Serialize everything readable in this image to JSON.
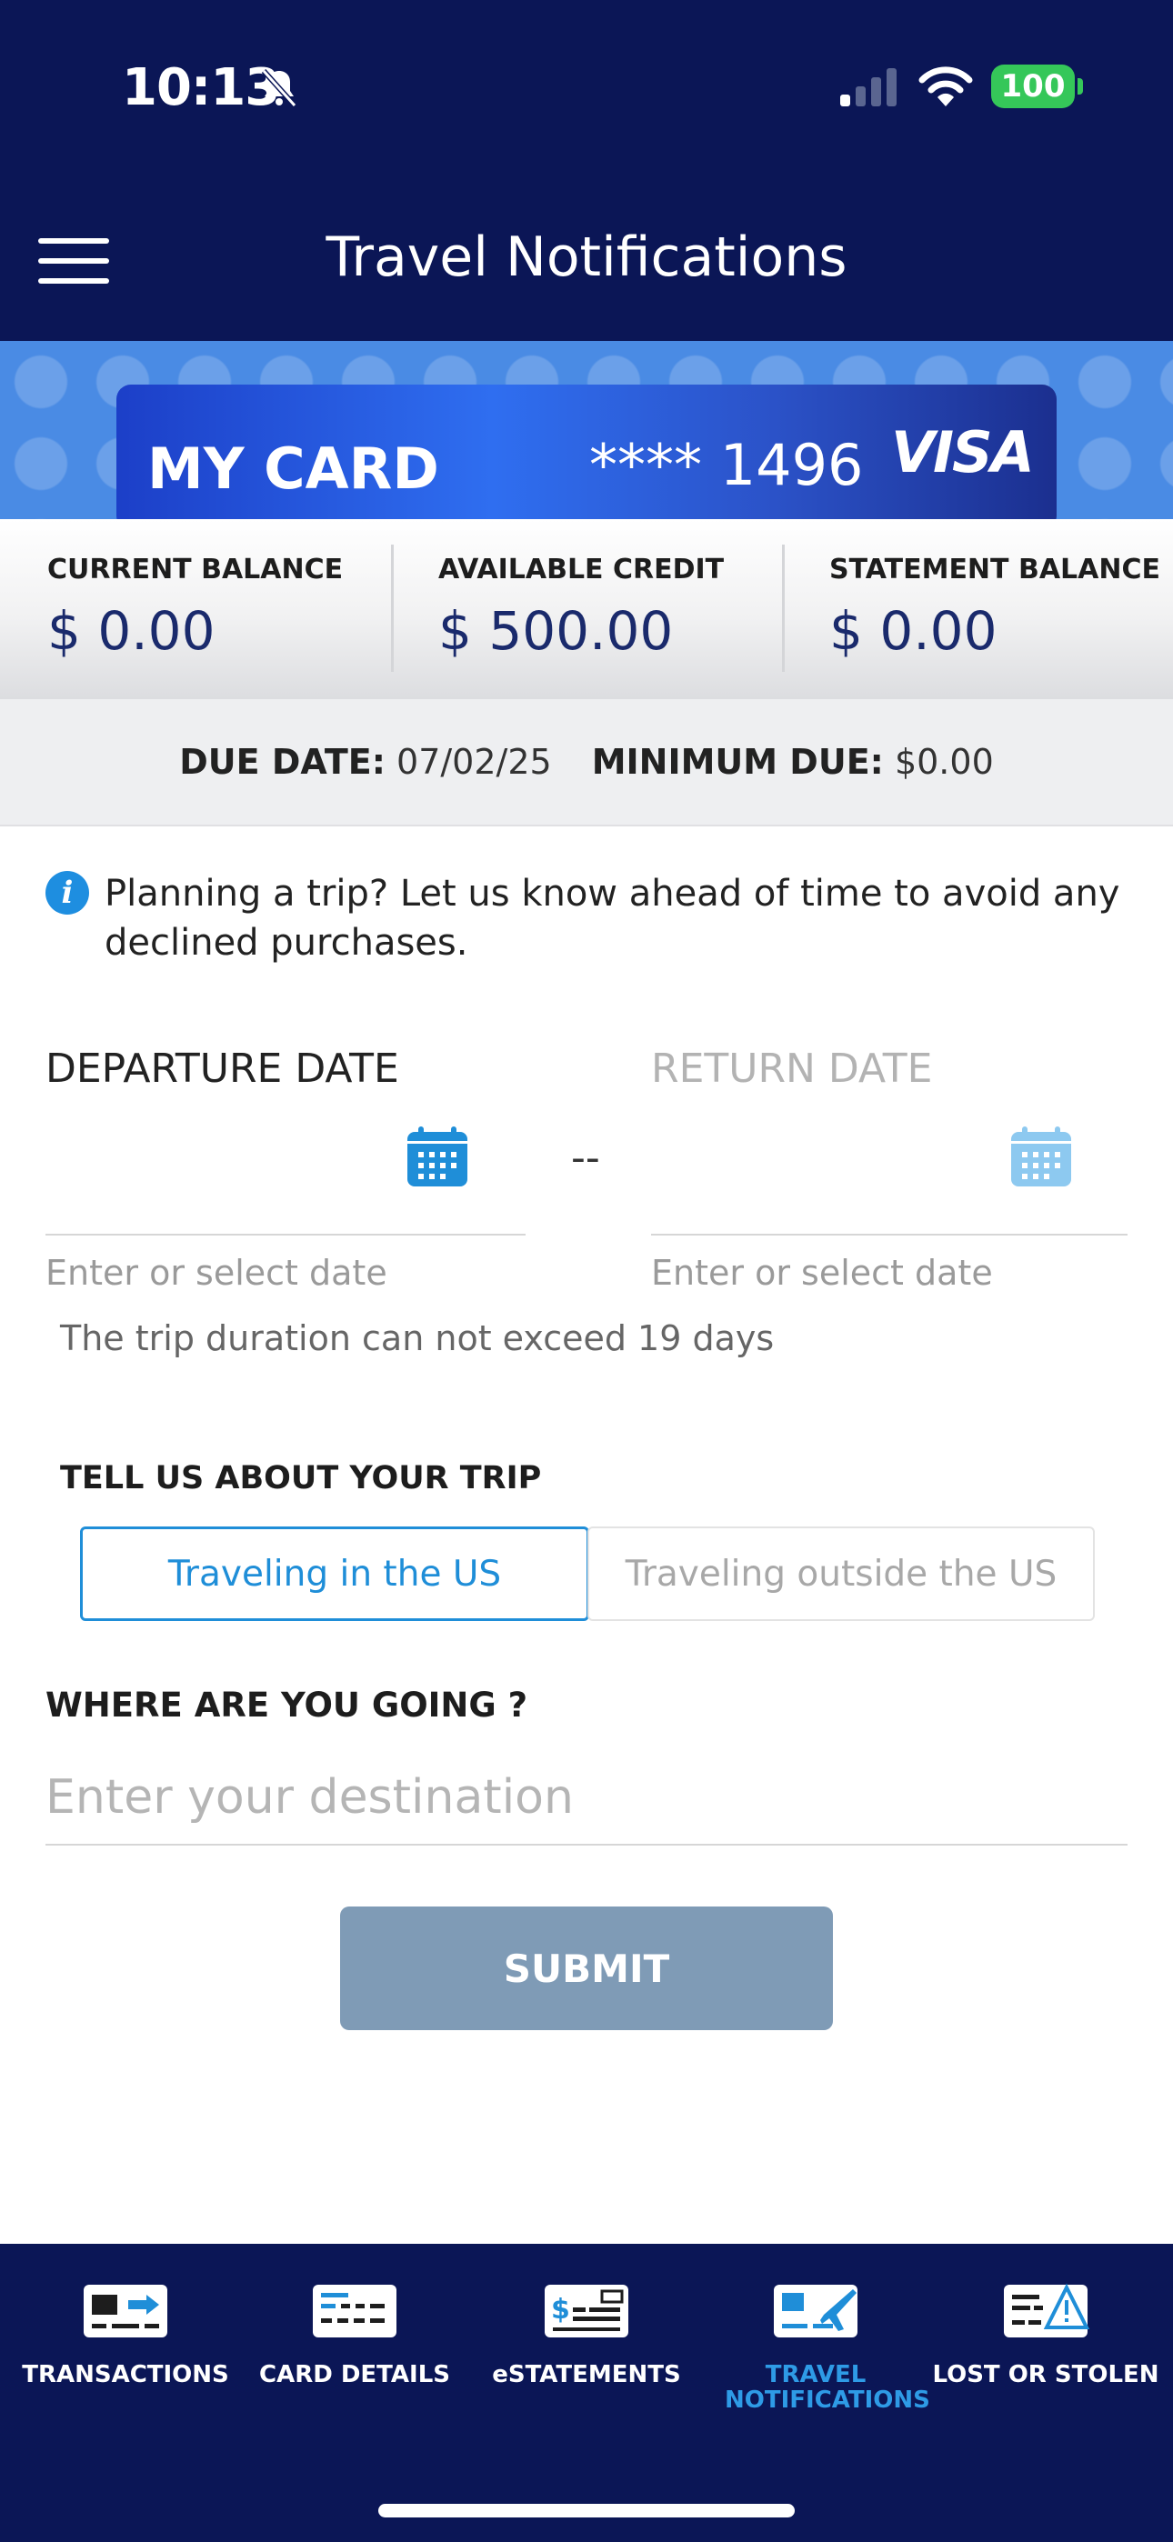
{
  "status_bar": {
    "time": "10:13",
    "battery": "100"
  },
  "header": {
    "title": "Travel Notifications"
  },
  "card": {
    "name": "MY CARD",
    "number": "**** 1496",
    "brand": "VISA"
  },
  "balances": [
    {
      "label": "CURRENT BALANCE",
      "value": "$ 0.00"
    },
    {
      "label": "AVAILABLE CREDIT",
      "value": "$ 500.00"
    },
    {
      "label": "STATEMENT BALANCE",
      "value": "$ 0.00"
    }
  ],
  "due": {
    "due_label": "DUE DATE:",
    "due_value": "07/02/25",
    "min_label": "MINIMUM DUE:",
    "min_value": "$0.00"
  },
  "info": {
    "text": "Planning a trip? Let us know ahead of time to avoid any declined purchases."
  },
  "dates": {
    "departure_label": "DEPARTURE DATE",
    "return_label": "RETURN DATE",
    "separator": "--",
    "departure_hint": "Enter or select date",
    "return_hint": "Enter or select date",
    "duration_note": "The trip duration can not exceed 19 days"
  },
  "trip": {
    "heading": "TELL US ABOUT YOUR TRIP",
    "options": [
      "Traveling in the US",
      "Traveling outside the US"
    ],
    "selected": "Traveling in the US"
  },
  "destination": {
    "heading": "WHERE ARE YOU GOING ?",
    "placeholder": "Enter your destination",
    "value": ""
  },
  "submit_label": "SUBMIT",
  "nav": {
    "items": [
      {
        "label": "TRANSACTIONS",
        "icon": "transactions-icon"
      },
      {
        "label": "CARD DETAILS",
        "icon": "card-details-icon"
      },
      {
        "label": "eSTATEMENTS",
        "icon": "estatements-icon"
      },
      {
        "label": "TRAVEL NOTIFICATIONS",
        "icon": "travel-icon",
        "active": true
      },
      {
        "label": "LOST OR STOLEN",
        "icon": "lost-stolen-icon"
      }
    ]
  },
  "colors": {
    "navy": "#0b1656",
    "accent": "#1f8ed8",
    "submit_disabled": "#7f9bb6"
  }
}
